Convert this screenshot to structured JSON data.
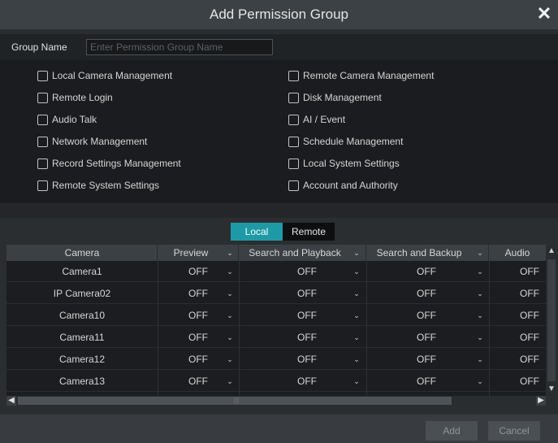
{
  "dialog": {
    "title": "Add Permission Group",
    "close_symbol": "✕"
  },
  "group_name": {
    "label": "Group Name",
    "placeholder": "Enter Permission Group Name",
    "value": ""
  },
  "permissions": {
    "left": [
      {
        "label": "Local Camera Management",
        "checked": false
      },
      {
        "label": "Remote Login",
        "checked": false
      },
      {
        "label": "Audio Talk",
        "checked": false
      },
      {
        "label": "Network Management",
        "checked": false
      },
      {
        "label": "Record Settings Management",
        "checked": false
      },
      {
        "label": "Remote System Settings",
        "checked": false
      }
    ],
    "right": [
      {
        "label": "Remote Camera Management",
        "checked": false
      },
      {
        "label": "Disk Management",
        "checked": false
      },
      {
        "label": "AI / Event",
        "checked": false
      },
      {
        "label": "Schedule Management",
        "checked": false
      },
      {
        "label": "Local System Settings",
        "checked": false
      },
      {
        "label": "Account and Authority",
        "checked": false
      }
    ]
  },
  "tabs": {
    "local": "Local",
    "remote": "Remote",
    "active": "Local"
  },
  "table": {
    "headers": {
      "camera": "Camera",
      "preview": "Preview",
      "search_playback": "Search and Playback",
      "search_backup": "Search and Backup",
      "audio": "Audio"
    },
    "rows": [
      {
        "camera": "Camera1",
        "preview": "OFF",
        "search_playback": "OFF",
        "search_backup": "OFF",
        "audio": "OFF"
      },
      {
        "camera": "IP Camera02",
        "preview": "OFF",
        "search_playback": "OFF",
        "search_backup": "OFF",
        "audio": "OFF"
      },
      {
        "camera": "Camera10",
        "preview": "OFF",
        "search_playback": "OFF",
        "search_backup": "OFF",
        "audio": "OFF"
      },
      {
        "camera": "Camera11",
        "preview": "OFF",
        "search_playback": "OFF",
        "search_backup": "OFF",
        "audio": "OFF"
      },
      {
        "camera": "Camera12",
        "preview": "OFF",
        "search_playback": "OFF",
        "search_backup": "OFF",
        "audio": "OFF"
      },
      {
        "camera": "Camera13",
        "preview": "OFF",
        "search_playback": "OFF",
        "search_backup": "OFF",
        "audio": "OFF"
      }
    ]
  },
  "footer": {
    "add_label": "Add",
    "cancel_label": "Cancel"
  },
  "icons": {
    "chevron_down": "chevron-down-icon",
    "scroll_up": "scroll-up-arrow-icon",
    "scroll_down": "scroll-down-arrow-icon",
    "scroll_left": "scroll-left-arrow-icon",
    "scroll_right": "scroll-right-arrow-icon"
  },
  "colors": {
    "accent": "#1e9aa6"
  }
}
